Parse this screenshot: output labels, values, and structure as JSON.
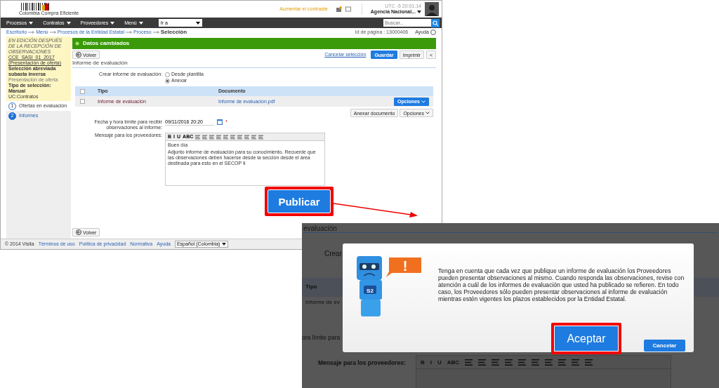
{
  "page": {
    "header": {
      "logo_text": "Colombia Compra Eficiente",
      "contrast_link": "Aumentar el contraste",
      "clock": "UTC -5 20:01:14",
      "user": "Agencia Nacional..."
    },
    "nav": {
      "menus": [
        "Procesos",
        "Contratos",
        "Proveedores",
        "Menú"
      ],
      "goto": "Ir a",
      "search_placeholder": "Buscar..."
    },
    "breadcrumb": [
      "Escritorio",
      "Menú",
      "Procesos de la Entidad Estatal",
      "Proceso",
      "Selección"
    ],
    "page_id": "Id de página : 13000406",
    "help": "Ayuda",
    "summary": {
      "status": "EN EDICIÓN DESPUÉS DE LA RECEPCIÓN DE OBSERVACIONES",
      "process": "CCE_SASI_01_2017 (Presentación de oferta)",
      "type": "Selección abreviada subasta inversa",
      "phase": "Presentación de oferta",
      "selection": "Tipo de selección: Manual",
      "unit": "UC:Contratos"
    },
    "steps": [
      {
        "number": "1",
        "label": "Ofertas en evaluación",
        "selected": false
      },
      {
        "number": "2",
        "label": "Informes",
        "selected": true
      }
    ],
    "banner": "Datos cambiados",
    "back": "Volver",
    "cancel_link": "Cancelar selección",
    "save": "Guardar",
    "print": "Imprimir",
    "collapse": "<",
    "section": "Informe de evaluación",
    "create": {
      "label": "Crear informe de evaluación:",
      "options": [
        {
          "label": "Desde plantilla",
          "selected": false
        },
        {
          "label": "Anexar",
          "selected": true
        }
      ]
    },
    "table": {
      "all_checked": false,
      "columns": [
        "Tipo",
        "Documento"
      ],
      "rows": [
        {
          "checked": false,
          "type": "Informe de evaluación",
          "document": "Informe de evaluacion.pdf",
          "options": "Opciones"
        }
      ]
    },
    "attach": "Anexar documento",
    "options": "Opciones",
    "deadline": {
      "label": "Fecha y hora límite para recibir observaciones al informe:",
      "value": "09/11/2016 20:20",
      "required": "*"
    },
    "message": {
      "label": "Mensaje para los proveedores:",
      "toolbar": [
        "B",
        "I",
        "U",
        "ABC"
      ],
      "lines": [
        "Buen día",
        "Adjunto informe de evaluación para su conocimiento. Recuerde que las observaciones deben hacerse desde la sección desde el área destinada para esto en el SECOP II"
      ]
    },
    "publish": "Publicar",
    "back_bottom": "Volver",
    "footer": {
      "copyright": "© 2014 Visita",
      "links": [
        "Términos de uso",
        "Política de privacidad",
        "Normativa",
        "Ayuda"
      ],
      "language": "Español (Colombia)"
    }
  },
  "dialog_view": {
    "heading": "evaluación",
    "create_label": "Crear",
    "column": "Tipo",
    "row": "Informe de ev",
    "deadline_label": "ora límite para",
    "message_label": "Mensaje para los proveedores:",
    "toolbar": [
      "B",
      "I",
      "U",
      "ABC"
    ],
    "dialog": {
      "alert": "!",
      "badge": "S2",
      "text": "Tenga en cuenta que cada vez que publique un informe de evaluación los Proveedores pueden presentar observaciones al mismo. Cuando responda las observaciones, revise con atención a cuál de los informes de evaluación que usted ha publicado se refieren. En todo caso, los Proveedores sólo pueden presentar observaciones al informe de evaluación mientras estén vigentes los plazos establecidos por la Entidad Estatal.",
      "accept": "Aceptar",
      "cancel": "Cancelar"
    }
  }
}
